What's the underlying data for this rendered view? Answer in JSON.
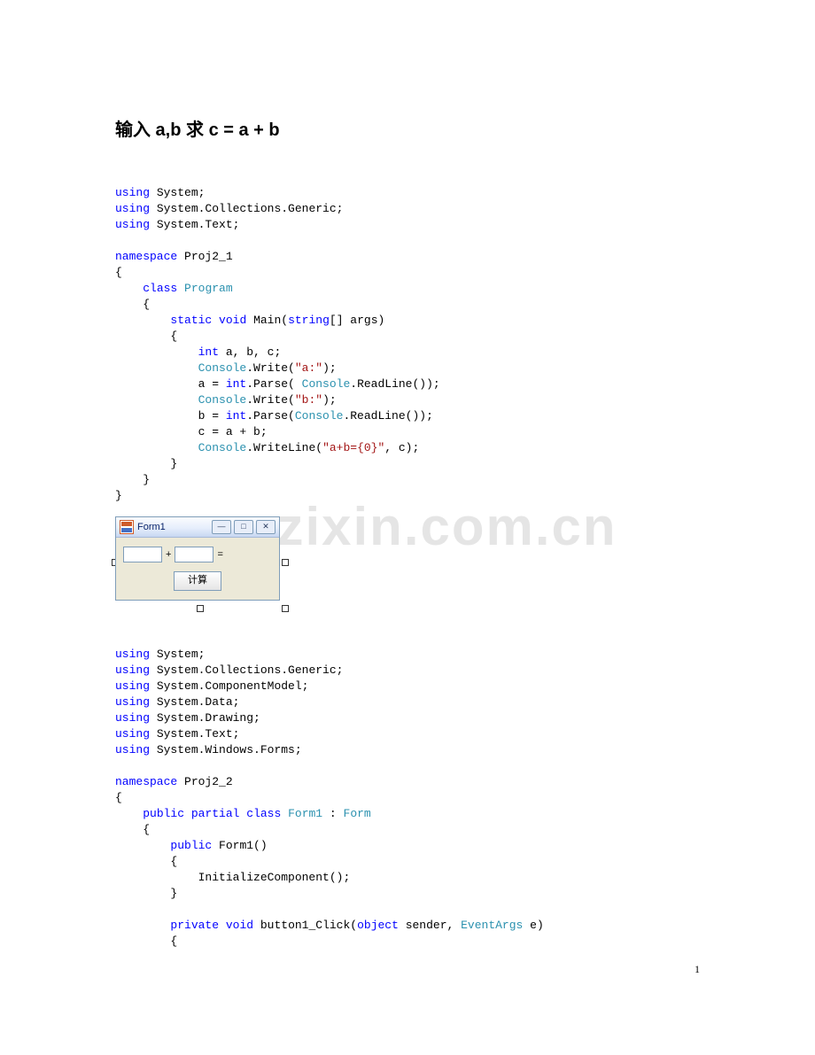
{
  "heading": "输入 a,b 求 c = a + b",
  "watermark": "www.zixin.com.cn",
  "page_number": "1",
  "form": {
    "title": "Form1",
    "op_plus": "+",
    "op_eq": "=",
    "button_label": "计算",
    "btn_min": "—",
    "btn_max": "□",
    "btn_close": "✕"
  },
  "code1": [
    [
      [
        "kw-blue",
        "using"
      ],
      [
        "kw-black",
        " System;"
      ]
    ],
    [
      [
        "kw-blue",
        "using"
      ],
      [
        "kw-black",
        " System.Collections.Generic;"
      ]
    ],
    [
      [
        "kw-blue",
        "using"
      ],
      [
        "kw-black",
        " System.Text;"
      ]
    ],
    [
      [
        "kw-black",
        ""
      ]
    ],
    [
      [
        "kw-blue",
        "namespace"
      ],
      [
        "kw-black",
        " Proj2_1"
      ]
    ],
    [
      [
        "kw-black",
        "{"
      ]
    ],
    [
      [
        "kw-black",
        "    "
      ],
      [
        "kw-blue",
        "class"
      ],
      [
        "kw-black",
        " "
      ],
      [
        "kw-teal",
        "Program"
      ]
    ],
    [
      [
        "kw-black",
        "    {"
      ]
    ],
    [
      [
        "kw-black",
        "        "
      ],
      [
        "kw-blue",
        "static"
      ],
      [
        "kw-black",
        " "
      ],
      [
        "kw-blue",
        "void"
      ],
      [
        "kw-black",
        " Main("
      ],
      [
        "kw-blue",
        "string"
      ],
      [
        "kw-black",
        "[] args)"
      ]
    ],
    [
      [
        "kw-black",
        "        {"
      ]
    ],
    [
      [
        "kw-black",
        "            "
      ],
      [
        "kw-blue",
        "int"
      ],
      [
        "kw-black",
        " a, b, c;"
      ]
    ],
    [
      [
        "kw-black",
        "            "
      ],
      [
        "kw-teal",
        "Console"
      ],
      [
        "kw-black",
        ".Write("
      ],
      [
        "kw-red",
        "\"a:\""
      ],
      [
        "kw-black",
        ");"
      ]
    ],
    [
      [
        "kw-black",
        "            a = "
      ],
      [
        "kw-blue",
        "int"
      ],
      [
        "kw-black",
        ".Parse( "
      ],
      [
        "kw-teal",
        "Console"
      ],
      [
        "kw-black",
        ".ReadLine());"
      ]
    ],
    [
      [
        "kw-black",
        "            "
      ],
      [
        "kw-teal",
        "Console"
      ],
      [
        "kw-black",
        ".Write("
      ],
      [
        "kw-red",
        "\"b:\""
      ],
      [
        "kw-black",
        ");"
      ]
    ],
    [
      [
        "kw-black",
        "            b = "
      ],
      [
        "kw-blue",
        "int"
      ],
      [
        "kw-black",
        ".Parse("
      ],
      [
        "kw-teal",
        "Console"
      ],
      [
        "kw-black",
        ".ReadLine());"
      ]
    ],
    [
      [
        "kw-black",
        "            c = a + b;"
      ]
    ],
    [
      [
        "kw-black",
        "            "
      ],
      [
        "kw-teal",
        "Console"
      ],
      [
        "kw-black",
        ".WriteLine("
      ],
      [
        "kw-red",
        "\"a+b={0}\""
      ],
      [
        "kw-black",
        ", c);"
      ]
    ],
    [
      [
        "kw-black",
        "        }"
      ]
    ],
    [
      [
        "kw-black",
        "    }"
      ]
    ],
    [
      [
        "kw-black",
        "}"
      ]
    ]
  ],
  "code2": [
    [
      [
        "kw-blue",
        "using"
      ],
      [
        "kw-black",
        " System;"
      ]
    ],
    [
      [
        "kw-blue",
        "using"
      ],
      [
        "kw-black",
        " System.Collections.Generic;"
      ]
    ],
    [
      [
        "kw-blue",
        "using"
      ],
      [
        "kw-black",
        " System.ComponentModel;"
      ]
    ],
    [
      [
        "kw-blue",
        "using"
      ],
      [
        "kw-black",
        " System.Data;"
      ]
    ],
    [
      [
        "kw-blue",
        "using"
      ],
      [
        "kw-black",
        " System.Drawing;"
      ]
    ],
    [
      [
        "kw-blue",
        "using"
      ],
      [
        "kw-black",
        " System.Text;"
      ]
    ],
    [
      [
        "kw-blue",
        "using"
      ],
      [
        "kw-black",
        " System.Windows.Forms;"
      ]
    ],
    [
      [
        "kw-black",
        ""
      ]
    ],
    [
      [
        "kw-blue",
        "namespace"
      ],
      [
        "kw-black",
        " Proj2_2"
      ]
    ],
    [
      [
        "kw-black",
        "{"
      ]
    ],
    [
      [
        "kw-black",
        "    "
      ],
      [
        "kw-blue",
        "public"
      ],
      [
        "kw-black",
        " "
      ],
      [
        "kw-blue",
        "partial"
      ],
      [
        "kw-black",
        " "
      ],
      [
        "kw-blue",
        "class"
      ],
      [
        "kw-black",
        " "
      ],
      [
        "kw-teal",
        "Form1"
      ],
      [
        "kw-black",
        " : "
      ],
      [
        "kw-teal",
        "Form"
      ]
    ],
    [
      [
        "kw-black",
        "    {"
      ]
    ],
    [
      [
        "kw-black",
        "        "
      ],
      [
        "kw-blue",
        "public"
      ],
      [
        "kw-black",
        " Form1()"
      ]
    ],
    [
      [
        "kw-black",
        "        {"
      ]
    ],
    [
      [
        "kw-black",
        "            InitializeComponent();"
      ]
    ],
    [
      [
        "kw-black",
        "        }"
      ]
    ],
    [
      [
        "kw-black",
        ""
      ]
    ],
    [
      [
        "kw-black",
        "        "
      ],
      [
        "kw-blue",
        "private"
      ],
      [
        "kw-black",
        " "
      ],
      [
        "kw-blue",
        "void"
      ],
      [
        "kw-black",
        " button1_Click("
      ],
      [
        "kw-blue",
        "object"
      ],
      [
        "kw-black",
        " sender, "
      ],
      [
        "kw-teal",
        "EventArgs"
      ],
      [
        "kw-black",
        " e)"
      ]
    ],
    [
      [
        "kw-black",
        "        {"
      ]
    ]
  ]
}
